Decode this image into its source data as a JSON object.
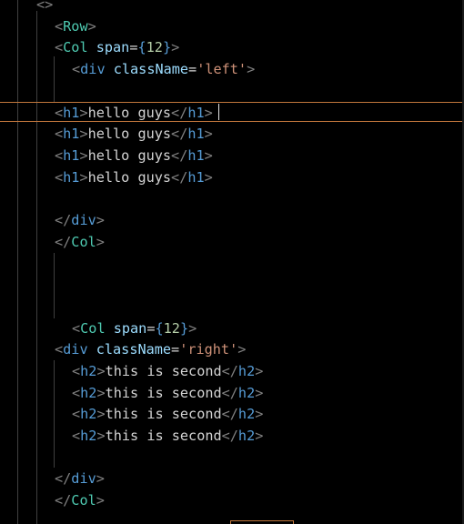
{
  "editor": {
    "lines": [
      {
        "indent": 40,
        "tokens": [
          {
            "t": "<>",
            "c": "tag"
          }
        ]
      },
      {
        "indent": 60,
        "tokens": [
          {
            "t": "<",
            "c": "tag"
          },
          {
            "t": "Row",
            "c": "comp"
          },
          {
            "t": ">",
            "c": "tag"
          }
        ]
      },
      {
        "indent": 60,
        "tokens": [
          {
            "t": "<",
            "c": "tag"
          },
          {
            "t": "Col",
            "c": "comp"
          },
          {
            "t": " ",
            "c": "txt"
          },
          {
            "t": "span",
            "c": "attr"
          },
          {
            "t": "=",
            "c": "punc"
          },
          {
            "t": "{",
            "c": "elem"
          },
          {
            "t": "12",
            "c": "num"
          },
          {
            "t": "}",
            "c": "elem"
          },
          {
            "t": ">",
            "c": "tag"
          }
        ]
      },
      {
        "indent": 79,
        "tokens": [
          {
            "t": "<",
            "c": "tag"
          },
          {
            "t": "div",
            "c": "elem"
          },
          {
            "t": " ",
            "c": "txt"
          },
          {
            "t": "className",
            "c": "attr"
          },
          {
            "t": "=",
            "c": "punc"
          },
          {
            "t": "'left'",
            "c": "str"
          },
          {
            "t": ">",
            "c": "tag"
          }
        ]
      },
      {
        "indent": 0,
        "tokens": []
      },
      {
        "indent": 60,
        "tokens": [
          {
            "t": "<",
            "c": "tag"
          },
          {
            "t": "h1",
            "c": "elem"
          },
          {
            "t": ">",
            "c": "tag"
          },
          {
            "t": "hello guys",
            "c": "txt"
          },
          {
            "t": "</",
            "c": "tag"
          },
          {
            "t": "h1",
            "c": "elem"
          },
          {
            "t": ">",
            "c": "tag"
          }
        ]
      },
      {
        "indent": 60,
        "tokens": [
          {
            "t": "<",
            "c": "tag"
          },
          {
            "t": "h1",
            "c": "elem"
          },
          {
            "t": ">",
            "c": "tag"
          },
          {
            "t": "hello guys",
            "c": "txt"
          },
          {
            "t": "</",
            "c": "tag"
          },
          {
            "t": "h1",
            "c": "elem"
          },
          {
            "t": ">",
            "c": "tag"
          }
        ]
      },
      {
        "indent": 60,
        "tokens": [
          {
            "t": "<",
            "c": "tag"
          },
          {
            "t": "h1",
            "c": "elem"
          },
          {
            "t": ">",
            "c": "tag"
          },
          {
            "t": "hello guys",
            "c": "txt"
          },
          {
            "t": "</",
            "c": "tag"
          },
          {
            "t": "h1",
            "c": "elem"
          },
          {
            "t": ">",
            "c": "tag"
          }
        ]
      },
      {
        "indent": 60,
        "tokens": [
          {
            "t": "<",
            "c": "tag"
          },
          {
            "t": "h1",
            "c": "elem"
          },
          {
            "t": ">",
            "c": "tag"
          },
          {
            "t": "hello guys",
            "c": "txt"
          },
          {
            "t": "</",
            "c": "tag"
          },
          {
            "t": "h1",
            "c": "elem"
          },
          {
            "t": ">",
            "c": "tag"
          }
        ]
      },
      {
        "indent": 0,
        "tokens": []
      },
      {
        "indent": 60,
        "tokens": [
          {
            "t": "</",
            "c": "tag"
          },
          {
            "t": "div",
            "c": "elem"
          },
          {
            "t": ">",
            "c": "tag"
          }
        ]
      },
      {
        "indent": 60,
        "tokens": [
          {
            "t": "</",
            "c": "tag"
          },
          {
            "t": "Col",
            "c": "comp"
          },
          {
            "t": ">",
            "c": "tag"
          }
        ]
      },
      {
        "indent": 0,
        "tokens": []
      },
      {
        "indent": 0,
        "tokens": []
      },
      {
        "indent": 0,
        "tokens": []
      },
      {
        "indent": 79,
        "tokens": [
          {
            "t": "<",
            "c": "tag"
          },
          {
            "t": "Col",
            "c": "comp"
          },
          {
            "t": " ",
            "c": "txt"
          },
          {
            "t": "span",
            "c": "attr"
          },
          {
            "t": "=",
            "c": "punc"
          },
          {
            "t": "{",
            "c": "elem"
          },
          {
            "t": "12",
            "c": "num"
          },
          {
            "t": "}",
            "c": "elem"
          },
          {
            "t": ">",
            "c": "tag"
          }
        ]
      },
      {
        "indent": 60,
        "tokens": [
          {
            "t": "<",
            "c": "tag"
          },
          {
            "t": "div",
            "c": "elem"
          },
          {
            "t": " ",
            "c": "txt"
          },
          {
            "t": "className",
            "c": "attr"
          },
          {
            "t": "=",
            "c": "punc"
          },
          {
            "t": "'right'",
            "c": "str"
          },
          {
            "t": ">",
            "c": "tag"
          }
        ]
      },
      {
        "indent": 79,
        "tokens": [
          {
            "t": "<",
            "c": "tag"
          },
          {
            "t": "h2",
            "c": "elem"
          },
          {
            "t": ">",
            "c": "tag"
          },
          {
            "t": "this is second",
            "c": "txt"
          },
          {
            "t": "</",
            "c": "tag"
          },
          {
            "t": "h2",
            "c": "elem"
          },
          {
            "t": ">",
            "c": "tag"
          }
        ]
      },
      {
        "indent": 79,
        "tokens": [
          {
            "t": "<",
            "c": "tag"
          },
          {
            "t": "h2",
            "c": "elem"
          },
          {
            "t": ">",
            "c": "tag"
          },
          {
            "t": "this is second",
            "c": "txt"
          },
          {
            "t": "</",
            "c": "tag"
          },
          {
            "t": "h2",
            "c": "elem"
          },
          {
            "t": ">",
            "c": "tag"
          }
        ]
      },
      {
        "indent": 79,
        "tokens": [
          {
            "t": "<",
            "c": "tag"
          },
          {
            "t": "h2",
            "c": "elem"
          },
          {
            "t": ">",
            "c": "tag"
          },
          {
            "t": "this is second",
            "c": "txt"
          },
          {
            "t": "</",
            "c": "tag"
          },
          {
            "t": "h2",
            "c": "elem"
          },
          {
            "t": ">",
            "c": "tag"
          }
        ]
      },
      {
        "indent": 79,
        "tokens": [
          {
            "t": "<",
            "c": "tag"
          },
          {
            "t": "h2",
            "c": "elem"
          },
          {
            "t": ">",
            "c": "tag"
          },
          {
            "t": "this is second",
            "c": "txt"
          },
          {
            "t": "</",
            "c": "tag"
          },
          {
            "t": "h2",
            "c": "elem"
          },
          {
            "t": ">",
            "c": "tag"
          }
        ]
      },
      {
        "indent": 0,
        "tokens": []
      },
      {
        "indent": 60,
        "tokens": [
          {
            "t": "</",
            "c": "tag"
          },
          {
            "t": "div",
            "c": "elem"
          },
          {
            "t": ">",
            "c": "tag"
          }
        ]
      },
      {
        "indent": 60,
        "tokens": [
          {
            "t": "</",
            "c": "tag"
          },
          {
            "t": "Col",
            "c": "comp"
          },
          {
            "t": ">",
            "c": "tag"
          }
        ]
      }
    ],
    "active_line": 5
  },
  "colors": {
    "background": "#000000",
    "tag_bracket": "#808080",
    "html_element": "#569cd6",
    "component": "#4ec9b0",
    "attribute": "#9cdcfe",
    "string": "#ce9178",
    "number": "#b5cea8",
    "text": "#d4d4d4",
    "active_line_border": "#c2773c"
  }
}
